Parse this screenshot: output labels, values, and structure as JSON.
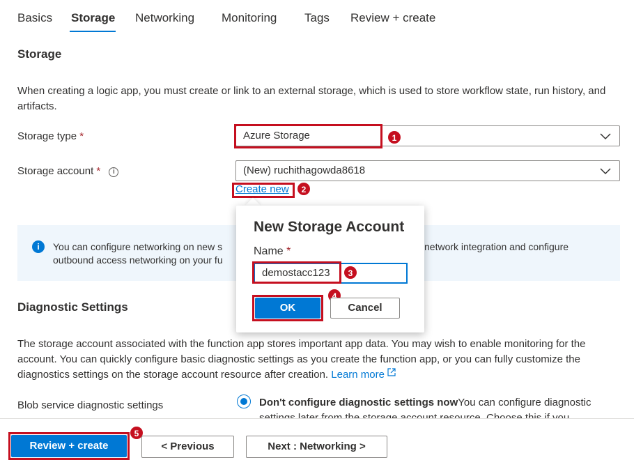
{
  "tabs": [
    "Basics",
    "Storage",
    "Networking",
    "Monitoring",
    "Tags",
    "Review + create"
  ],
  "storage": {
    "title": "Storage",
    "description": "When creating a logic app, you must create or link to an external storage, which is used to store workflow state, run history, and artifacts.",
    "storage_type_label": "Storage type",
    "storage_type_value": "Azure Storage",
    "storage_account_label": "Storage account",
    "storage_account_value": "(New) ruchithagowda8618",
    "create_new_link": "Create new",
    "required_marker": "*"
  },
  "info_bar": {
    "line1_left": "You can configure networking on new s",
    "line1_right": "network integration and configure",
    "line2_left": "outbound access networking on your fu"
  },
  "popup": {
    "title": "New Storage Account",
    "name_label": "Name",
    "name_value": "demostacc123",
    "ok_label": "OK",
    "cancel_label": "Cancel"
  },
  "diagnostics": {
    "title": "Diagnostic Settings",
    "description": "The storage account associated with the function app stores important app data. You may wish to enable monitoring for the account. You can quickly configure basic diagnostic settings as you create the function app, or you can fully customize the diagnostics settings on the storage account resource after creation.",
    "learn_more": "Learn more",
    "blob_label": "Blob service diagnostic settings",
    "option_bold": "Don't configure diagnostic settings now",
    "option_text": "You can configure diagnostic",
    "option_text_line2": "settings later from the storage account resource. Choose this if you"
  },
  "footer": {
    "review_create": "Review + create",
    "previous": "< Previous",
    "next": "Next : Networking >"
  },
  "badges": [
    "1",
    "2",
    "3",
    "4",
    "5"
  ],
  "colors": {
    "accent": "#0078d4",
    "annotation_red": "#c50f1f",
    "info_bg": "#eff6fc"
  }
}
